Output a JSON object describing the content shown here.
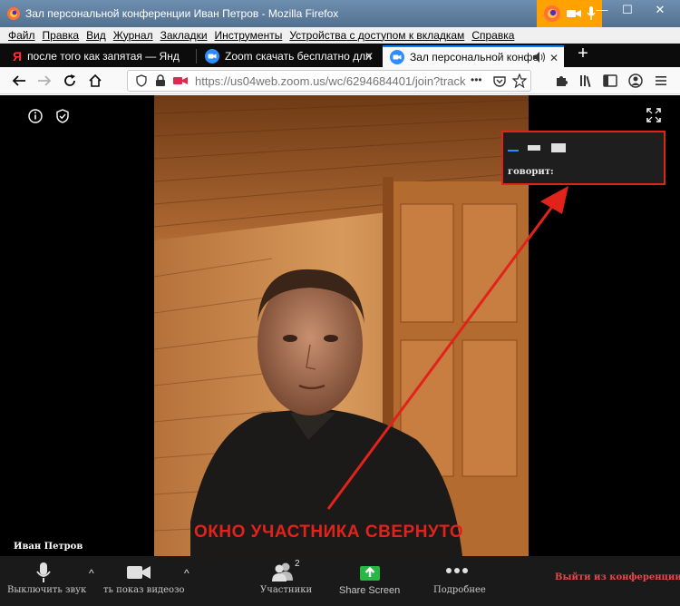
{
  "window": {
    "title": "Зал персональной конференции Иван Петров - Mozilla Firefox",
    "minimize": "—",
    "maximize": "☐",
    "close": "✕"
  },
  "menu": [
    "Файл",
    "Правка",
    "Вид",
    "Журнал",
    "Закладки",
    "Инструменты",
    "Устройства с доступом к вкладкам",
    "Справка"
  ],
  "tabs": [
    {
      "label": "после того как запятая — Янд",
      "icon": "yandex-icon",
      "active": false
    },
    {
      "label": "Zoom скачать бесплатно для",
      "icon": "zoom-icon",
      "active": false
    },
    {
      "label": "Зал персональной конфе",
      "icon": "zoom-icon",
      "active": true
    }
  ],
  "tab_close": "✕",
  "newtab": "+",
  "navbar": {
    "url": "https://us04web.zoom.us/wc/6294684401/join?track",
    "more": "•••"
  },
  "meeting": {
    "speaking_label": "говорит:",
    "participant_name": "Иван Петров",
    "annotation": "ОКНО УЧАСТНИКА СВЕРНУТО",
    "participants_count": "2"
  },
  "toolbar": {
    "mute": "Выключить звук",
    "video": "ть показ видеозо",
    "participants": "Участники",
    "share": "Share Screen",
    "more": "Подробнее",
    "leave": "Выйти из конференции",
    "caret": "^"
  },
  "colors": {
    "annotation_red": "#e0231b",
    "share_green": "#27b745",
    "accent_blue": "#0a84ff",
    "share_indicator": "#ffa200"
  }
}
